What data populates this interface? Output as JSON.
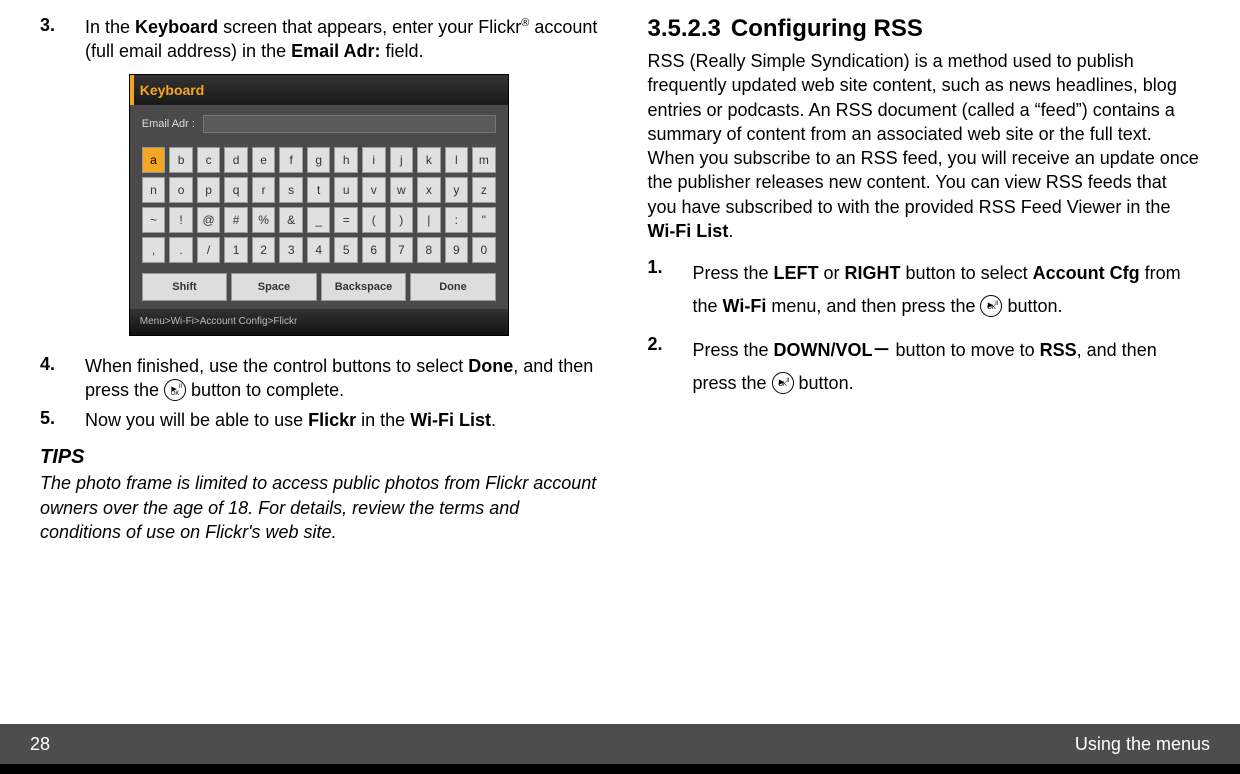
{
  "left": {
    "steps": [
      {
        "num": "3.",
        "parts": [
          "In the ",
          "<b>Keyboard</b>",
          " screen that appears, enter your Flickr",
          "<sup>®</sup>",
          " account (full email address) in the ",
          "<b>Email Adr:</b>",
          " field."
        ]
      },
      {
        "num": "4.",
        "pre": "When finished, use the control buttons to select ",
        "bold1": "Done",
        "mid": ", and then press the ",
        "post": " button to complete."
      },
      {
        "num": "5.",
        "pre": "Now you will be able to use ",
        "bold1": "Flickr",
        "mid": " in the ",
        "bold2": "Wi-Fi List",
        "post": "."
      }
    ],
    "tips_head": "TIPS",
    "tips_body": "The photo frame is limited to access public photos from Flickr account owners over the age of 18. For details, review the terms and conditions of use on Flickr's web site."
  },
  "keyboard": {
    "title": "Keyboard",
    "field_label": "Email Adr  :",
    "rows": [
      [
        "a",
        "b",
        "c",
        "d",
        "e",
        "f",
        "g",
        "h",
        "i",
        "j",
        "k",
        "l",
        "m"
      ],
      [
        "n",
        "o",
        "p",
        "q",
        "r",
        "s",
        "t",
        "u",
        "v",
        "w",
        "x",
        "y",
        "z"
      ],
      [
        "~",
        "!",
        "@",
        "#",
        "%",
        "&",
        "_",
        "=",
        "(",
        ")",
        "|",
        ":",
        "\""
      ],
      [
        ",",
        ".",
        "/",
        "1",
        "2",
        "3",
        "4",
        "5",
        "6",
        "7",
        "8",
        "9",
        "0"
      ]
    ],
    "selected": "a",
    "bottom": [
      "Shift",
      "Space",
      "Backspace",
      "Done"
    ],
    "breadcrumb": "Menu>Wi-Fi>Account Config>Flickr"
  },
  "right": {
    "heading_num": "3.5.2.3",
    "heading_title": "Configuring RSS",
    "intro_parts": [
      "RSS (Really Simple Syndication) is a method used to publish frequently updated web site content, such as news headlines, blog entries or podcasts. An RSS document (called a “feed”) contains a summary of content from an associated web site or the full text. When you subscribe to an RSS feed, you will receive an update once the publisher releases new content. You can view RSS feeds that you have subscribed to with the provided RSS Feed Viewer in the ",
      "<b>Wi-Fi List</b>",
      "."
    ],
    "steps": [
      {
        "num": "1.",
        "pre": "Press the ",
        "b1": "LEFT",
        "mid1": " or ",
        "b2": "RIGHT",
        "mid2": " button to select ",
        "b3": "Account Cfg",
        "mid3": " from the ",
        "b4": "Wi-Fi",
        "mid4": " menu, and then press the ",
        "post": " button."
      },
      {
        "num": "2.",
        "pre": "Press the ",
        "b1": "DOWN/VOL－",
        "mid1": " button to move to ",
        "b2": "RSS",
        "mid2": ", and then press the ",
        "post": " button."
      }
    ]
  },
  "footer": {
    "page": "28",
    "title": "Using the menus"
  }
}
